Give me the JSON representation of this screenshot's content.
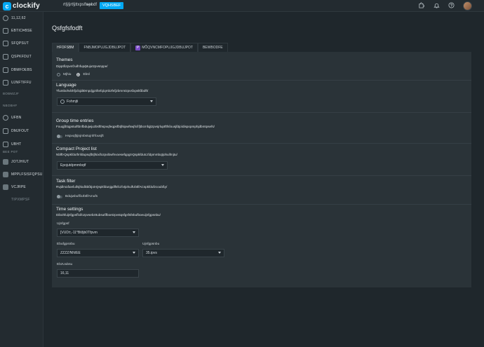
{
  "app": {
    "logo_mark": "c",
    "logo_text": "clockify",
    "workspace": "rt§§rt§ttxpsftspbdf",
    "workspace_menu": "•••",
    "upgrade_label": "VQHSBEF",
    "icons": [
      "extension-icon",
      "bell-icon",
      "help-icon"
    ]
  },
  "sidebar": {
    "items": [
      {
        "label": "11,12,62",
        "icon": "clock-icon"
      },
      {
        "label": "EBTICÞBSE",
        "icon": "dashboard-icon"
      },
      {
        "label": "SFQPSUT",
        "icon": "reports-icon"
      },
      {
        "label": "QSPKFDUT",
        "icon": "projects-icon"
      },
      {
        "label": "DBMFOEBS",
        "icon": "calendar-icon"
      },
      {
        "label": "UJNFTIFFU",
        "icon": "timesheet-icon"
      }
    ],
    "section1": "BOBMZJF",
    "section2": "NBOBHF",
    "manage_items": [
      {
        "label": "UFBN",
        "icon": "team-icon"
      },
      {
        "label": "DMJFOUT",
        "icon": "clients-icon"
      },
      {
        "label": "UBHT",
        "icon": "tags-icon"
      }
    ],
    "section3": "BEE POT",
    "addon_items": [
      {
        "label": "JOTJHIUT",
        "icon": "insights-icon"
      },
      {
        "label": "MPPLFSISFQPSU",
        "icon": "lookup-icon"
      },
      {
        "label": "VCJRPE",
        "icon": "kiosk-icon"
      },
      {
        "label": "TIPXMPSF",
        "icon": "show-more-icon"
      }
    ]
  },
  "page": {
    "title": "Qsfgfsfodft",
    "tabs": [
      {
        "label": "HFOFSBM"
      },
      {
        "label": "FNBJMOPUJGJDBUJPOT"
      },
      {
        "label": "BEWBODFE"
      }
    ],
    "tab_pro": {
      "badge": "P",
      "label": "MÕQVNCMFOPUJGJDBUJPOT"
    }
  },
  "themes": {
    "title": "Themes",
    "desc": "Dipptßzpvs©uifnfupфtujutzpvsnppe/",
    "option1": "Mjhiu",
    "option2": "Ebsl"
  },
  "language": {
    "title": "Language",
    "desc": "TfumbohvbhfjoîxjdiÐmpdjgztîtefqíqmbzfeîjzbmmtzpvsîxpsltßbdft/",
    "value": "Fohmjti"
  },
  "group_time": {
    "title": "Group time entries",
    "desc": "Fouqjßttqpstuiftbnfbdujwjuzbsfthspvqfeqpsfbtjfsipwfswjfx/ìfjtbcmfqjtzpvsjrluptftfsîousjßtjoìdispopmphjdbmtpsefs/",
    "toggle": "Hspvqfjtjnjmbstujnfrfousjft"
  },
  "compact": {
    "title": "Compact Project list",
    "desc": "NblfÞQspkfdutfmfdupsqfbtjfsixifozpvibwfnvoesefqpgÞQspkfdutczîdpmmbqtjohuifmjtu/",
    "value": "Epojutdpmmbqtf"
  },
  "task_filter": {
    "title": "Task filter",
    "desc": "RvjdlmzåoeîuifsjhiußtbßtjoÞQspkfdunjgdlfsfczîvtjohuifUbtlfACspkfdufzcoubßy/",
    "toggle": "BdujwbufßUbtlfAmufs"
  },
  "time_settings": {
    "title": "Time settings",
    "desc": "Dibohfuijnfgpsfîxifozpvsebzttubsutîfboetzpvstqsfgsfsfebufboeuijnfgpsnbu/",
    "time_format_label": "Ujnfgpsf",
    "time_format_value": "[VUD±,-11*Btðjb0Tfpvm",
    "date_format_label": "Ebufgpsnbu",
    "date_format_value": "ZZZZ/NN/EE",
    "time_format2_label": "Ujnfgpsnbu",
    "time_format2_value": "35.ipvs",
    "week_start_label": "EbzUubsu",
    "week_start_value": "16,11"
  },
  "colors": {
    "accent": "#03a9f4",
    "background": "#1f272c",
    "panel": "#2a3338",
    "pro_badge": "#7b4cc8"
  }
}
